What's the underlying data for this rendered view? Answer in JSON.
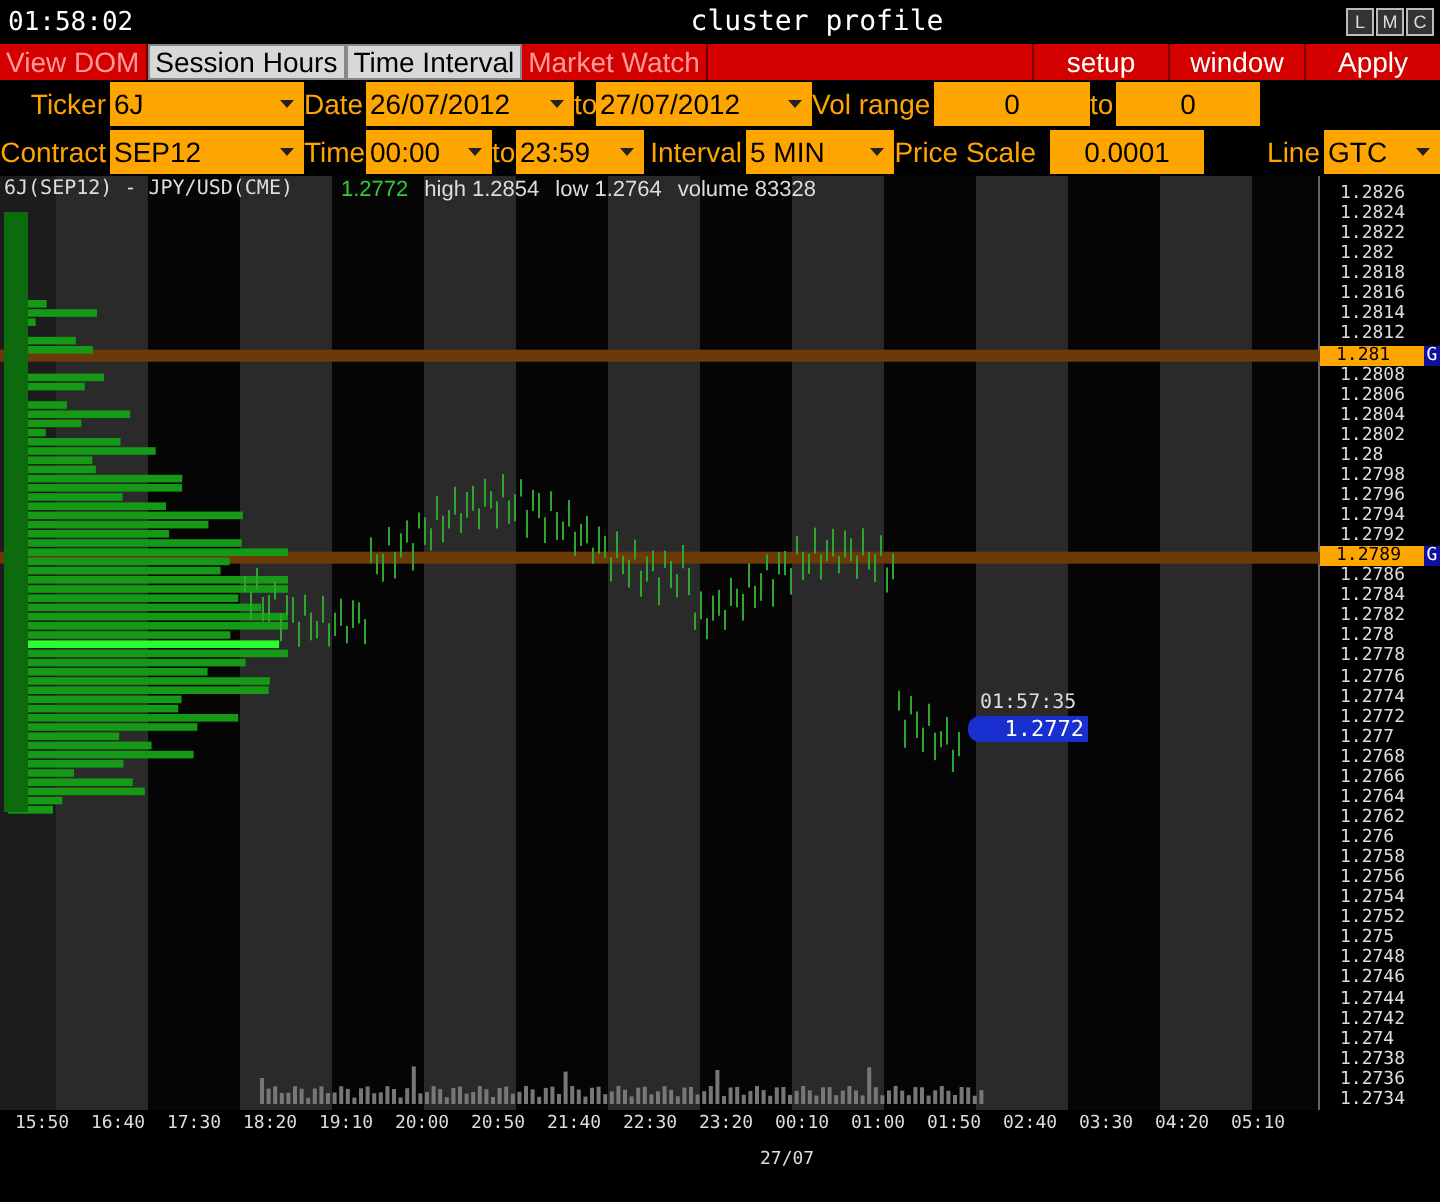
{
  "title_bar": {
    "clock": "01:58:02",
    "title": "cluster profile",
    "window_buttons": [
      "L",
      "M",
      "C"
    ]
  },
  "menu": {
    "tabs": [
      {
        "label": "View DOM",
        "selected": false
      },
      {
        "label": "Session Hours",
        "selected": true
      },
      {
        "label": "Time Interval",
        "selected": true
      },
      {
        "label": "Market Watch",
        "selected": false
      }
    ],
    "buttons": [
      "setup",
      "window",
      "Apply"
    ]
  },
  "form_rows": [
    [
      {
        "kind": "label",
        "text": "Ticker"
      },
      {
        "kind": "dropdown",
        "text": "6J"
      },
      {
        "kind": "label",
        "text": "Date"
      },
      {
        "kind": "dropdown",
        "text": "26/07/2012"
      },
      {
        "kind": "label",
        "text": "to"
      },
      {
        "kind": "dropdown",
        "text": "27/07/2012"
      },
      {
        "kind": "label",
        "text": "Vol range"
      },
      {
        "kind": "input",
        "text": "0"
      },
      {
        "kind": "label",
        "text": "to"
      },
      {
        "kind": "input",
        "text": "0"
      }
    ],
    [
      {
        "kind": "label",
        "text": "Contract"
      },
      {
        "kind": "dropdown",
        "text": "SEP12"
      },
      {
        "kind": "label",
        "text": "Time"
      },
      {
        "kind": "dropdown",
        "text": "00:00"
      },
      {
        "kind": "label",
        "text": "to"
      },
      {
        "kind": "dropdown",
        "text": "23:59"
      },
      {
        "kind": "label",
        "text": "Interval"
      },
      {
        "kind": "dropdown",
        "text": "5 MIN"
      },
      {
        "kind": "label",
        "text": "Price Scale"
      },
      {
        "kind": "input",
        "text": "0.0001"
      },
      {
        "kind": "label",
        "text": "Line"
      },
      {
        "kind": "dropdown",
        "text": "GTC"
      }
    ]
  ],
  "chart": {
    "instrument": "6J(SEP12) - JPY/USD(CME)",
    "last": "1.2772",
    "high": "high 1.2854",
    "low": "low 1.2764",
    "volume": "volume 83328",
    "last_tag": {
      "time": "01:57:35",
      "price": "1.2772"
    },
    "price_axis": [
      {
        "label": "1.2826"
      },
      {
        "label": "1.2824"
      },
      {
        "label": "1.2822"
      },
      {
        "label": "1.282"
      },
      {
        "label": "1.2818"
      },
      {
        "label": "1.2816"
      },
      {
        "label": "1.2814"
      },
      {
        "label": "1.2812"
      },
      {
        "label": "1.281",
        "level_line": true,
        "flag": "G"
      },
      {
        "label": "1.2808"
      },
      {
        "label": "1.2806"
      },
      {
        "label": "1.2804"
      },
      {
        "label": "1.2802"
      },
      {
        "label": "1.28"
      },
      {
        "label": "1.2798"
      },
      {
        "label": "1.2796"
      },
      {
        "label": "1.2794"
      },
      {
        "label": "1.2792"
      },
      {
        "label": "1.2789",
        "level_line": true,
        "flag": "G"
      },
      {
        "label": "1.2786"
      },
      {
        "label": "1.2784"
      },
      {
        "label": "1.2782"
      },
      {
        "label": "1.278"
      },
      {
        "label": "1.2778"
      },
      {
        "label": "1.2776"
      },
      {
        "label": "1.2774"
      },
      {
        "label": "1.2772"
      },
      {
        "label": "1.277"
      },
      {
        "label": "1.2768"
      },
      {
        "label": "1.2766"
      },
      {
        "label": "1.2764"
      },
      {
        "label": "1.2762"
      },
      {
        "label": "1.276"
      },
      {
        "label": "1.2758"
      },
      {
        "label": "1.2756"
      },
      {
        "label": "1.2754"
      },
      {
        "label": "1.2752"
      },
      {
        "label": "1.275"
      },
      {
        "label": "1.2748"
      },
      {
        "label": "1.2746"
      },
      {
        "label": "1.2744"
      },
      {
        "label": "1.2742"
      },
      {
        "label": "1.274"
      },
      {
        "label": "1.2738"
      },
      {
        "label": "1.2736"
      },
      {
        "label": "1.2734"
      }
    ],
    "time_axis": [
      "15:50",
      "16:40",
      "17:30",
      "18:20",
      "19:10",
      "20:00",
      "20:50",
      "21:40",
      "22:30",
      "23:20",
      "00:10",
      "01:00",
      "01:50",
      "02:40",
      "03:30",
      "04:20",
      "05:10"
    ],
    "date_label": "27/07"
  }
}
